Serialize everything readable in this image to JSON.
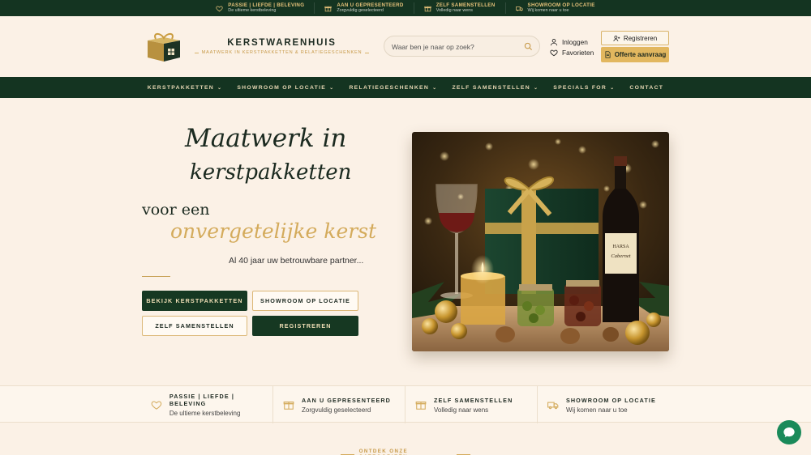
{
  "topbar": {
    "items": [
      {
        "icon": "heart-icon",
        "title": "PASSIE | LIEFDE | BELEVING",
        "sub": "De ultieme kerstbeleving"
      },
      {
        "icon": "gift-icon",
        "title": "AAN U GEPRESENTEERD",
        "sub": "Zorgvuldig geselecteerd"
      },
      {
        "icon": "gift-icon",
        "title": "ZELF SAMENSTELLEN",
        "sub": "Volledig naar wens"
      },
      {
        "icon": "truck-icon",
        "title": "SHOWROOM OP LOCATIE",
        "sub": "Wij komen naar u toe"
      }
    ]
  },
  "header": {
    "brand_name": "KERSTWARENHUIS",
    "brand_sub": "MAATWERK IN KERSTPAKKETTEN & RELATIEGESCHENKEN",
    "search_placeholder": "Waar ben je naar op zoek?",
    "login_label": "Inloggen",
    "favorites_label": "Favorieten",
    "register_label": "Registreren",
    "offer_label": "Offerte aanvraag"
  },
  "nav": {
    "items": [
      {
        "label": "KERSTPAKKETTEN",
        "dropdown": true
      },
      {
        "label": "SHOWROOM OP LOCATIE",
        "dropdown": true
      },
      {
        "label": "RELATIEGESCHENKEN",
        "dropdown": true
      },
      {
        "label": "ZELF SAMENSTELLEN",
        "dropdown": true
      },
      {
        "label": "SPECIALS FOR",
        "dropdown": true
      },
      {
        "label": "CONTACT",
        "dropdown": false
      }
    ]
  },
  "hero": {
    "title_line1": "Maatwerk in",
    "title_line2": "kerstpakketten",
    "voor_een": "voor een",
    "onvergetelijke": "onvergetelijke kerst",
    "tagline": "Al 40 jaar uw betrouwbare partner...",
    "buttons": {
      "bekijk": "BEKIJK KERSTPAKKETTEN",
      "showroom": "SHOWROOM OP LOCATIE",
      "zelf": "ZELF SAMENSTELLEN",
      "registreren": "REGISTREREN"
    },
    "wine_label_top": "HARSA",
    "wine_label_name": "Cabernet"
  },
  "features": [
    {
      "icon": "heart-icon",
      "title": "PASSIE | LIEFDE | BELEVING",
      "sub": "De ultieme kerstbeleving"
    },
    {
      "icon": "gift-icon",
      "title": "AAN U GEPRESENTEERD",
      "sub": "Zorgvuldig geselecteerd"
    },
    {
      "icon": "gift-icon",
      "title": "ZELF SAMENSTELLEN",
      "sub": "Volledig naar wens"
    },
    {
      "icon": "truck-icon",
      "title": "SHOWROOM OP LOCATIE",
      "sub": "Wij komen naar u toe"
    }
  ],
  "categories_heading": "ONTDEK ONZE CATEGORIEËN",
  "colors": {
    "dark_green": "#143421",
    "gold": "#d4ab5c",
    "cream": "#fbf1e6",
    "chat_green": "#1a8a5a"
  }
}
